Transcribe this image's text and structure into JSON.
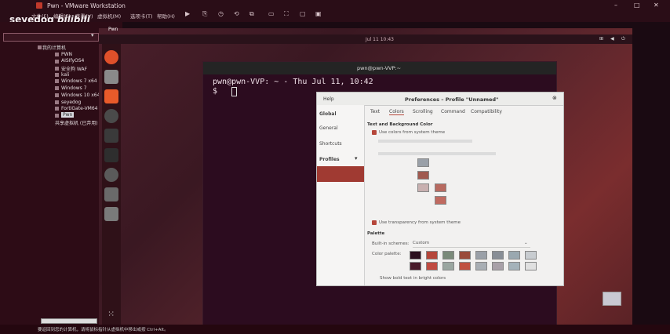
{
  "window": {
    "title": "Pwn - VMware Workstation"
  },
  "menubar": {
    "items": [
      "文件(F)",
      "编辑(E)",
      "查看(V)",
      "虚拟机(M)",
      "选项卡(T)",
      "帮助(H)"
    ]
  },
  "watermark": {
    "user": "seyedog",
    "brand": "bilibili"
  },
  "library": {
    "items": [
      {
        "label": "我的计算机",
        "level": 0
      },
      {
        "label": "PWN",
        "level": 1
      },
      {
        "label": "AISIfyOS4",
        "level": 1
      },
      {
        "label": "安全狗 WAF",
        "level": 1
      },
      {
        "label": "kali",
        "level": 1
      },
      {
        "label": "Windows 7 x64",
        "level": 1
      },
      {
        "label": "Windows 7",
        "level": 1
      },
      {
        "label": "Windows 10 x64",
        "level": 1
      },
      {
        "label": "seyedog",
        "level": 1
      },
      {
        "label": "FortiGate-VM64",
        "level": 1
      },
      {
        "label": "Pwn",
        "level": 1,
        "selected": true
      },
      {
        "label": "共享虚拟机 (已弃用)",
        "level": 0
      }
    ]
  },
  "vmtab": {
    "label": "Pwn"
  },
  "guest": {
    "clock": "Jul 11  10:43",
    "terminal": {
      "title": "pwn@pwn-VVP:~",
      "lines": [
        "pwn@pwn-VVP: ~ - Thu Jul 11, 10:42",
        "$ "
      ]
    },
    "prefs": {
      "help": "Help",
      "title": "Preferences – Profile \"Unnamed\"",
      "side": {
        "global_header": "Global",
        "general": "General",
        "shortcuts": "Shortcuts",
        "profiles_header": "Profiles",
        "profile_item": ""
      },
      "tabs": [
        "Text",
        "Colors",
        "Scrolling",
        "Command",
        "Compatibility"
      ],
      "section_text_bg": "Text and Background Color",
      "use_system_colors": "Use colors from system theme",
      "use_transparency": "Use transparency from system theme",
      "palette_header": "Palette",
      "builtin_label": "Built-in schemes:",
      "builtin_value": "Custom",
      "color_palette_label": "Color palette:",
      "bold_bright": "Show bold text in bright colors",
      "palette_colors": [
        "#2b0f1e",
        "#b5463a",
        "#7a8a7a",
        "#9a4a3a",
        "#9aa0a8",
        "#888e96",
        "#9aa8b0",
        "#c8ccd0",
        "#4a1a2a",
        "#c04a40",
        "#9aa6a0",
        "#c05040",
        "#a8aeb4",
        "#a8a0a8",
        "#a4b2ba",
        "#e0e0e0"
      ]
    }
  },
  "statusbar": {
    "text": "要返回到您的计算机，请将鼠标指针从虚拟机中移出或按 Ctrl+Alt。"
  }
}
